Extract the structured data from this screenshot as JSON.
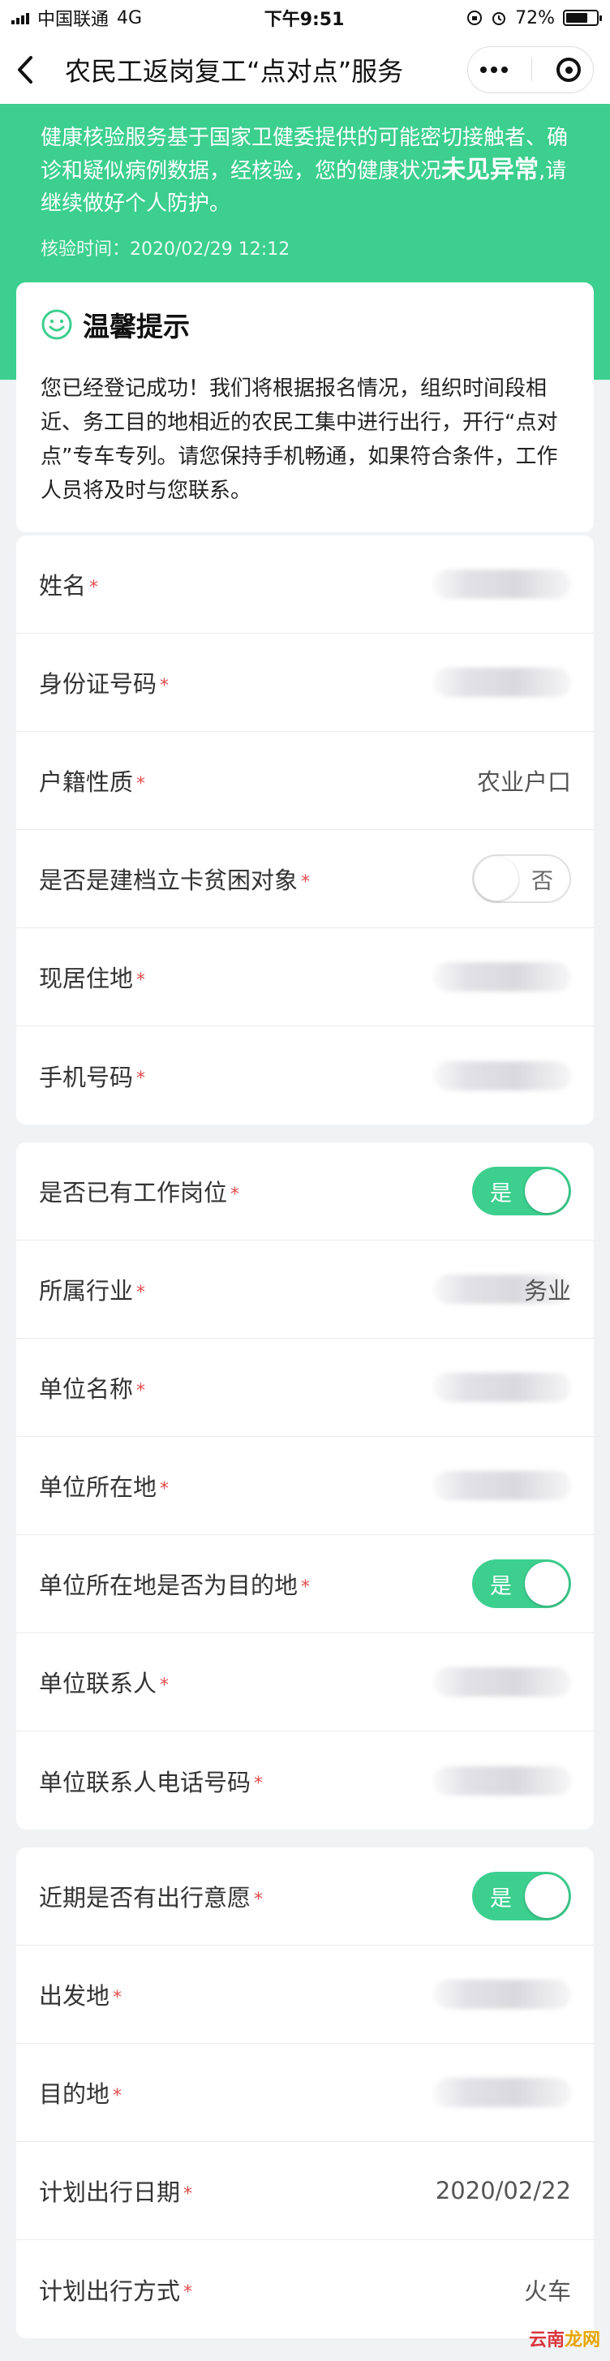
{
  "status_bar": {
    "carrier": "中国联通",
    "network": "4G",
    "time": "下午9:51",
    "battery": "72%",
    "battery_level": 0.72
  },
  "nav": {
    "title": "农民工返岗复工“点对点”服务"
  },
  "health": {
    "text_before": "健康核验服务基于国家卫健委提供的可能密切接触者、确诊和疑似病例数据，经核验，您的健康状况",
    "status": "未见异常",
    "text_after": ",请继续做好个人防护。",
    "verify_time": "核验时间：2020/02/29 12:12"
  },
  "tip": {
    "title": "温馨提示",
    "body": "您已经登记成功！我们将根据报名情况，组织时间段相近、务工目的地相近的农民工集中进行出行，开行“点对点”专车专列。请您保持手机畅通，如果符合条件，工作人员将及时与您联系。"
  },
  "required_mark": "*",
  "sections": [
    {
      "rows": [
        {
          "label": "姓名",
          "kind": "blur"
        },
        {
          "label": "身份证号码",
          "kind": "blur"
        },
        {
          "label": "户籍性质",
          "kind": "text",
          "value": "农业户口"
        },
        {
          "label": "是否是建档立卡贫困对象",
          "kind": "toggle",
          "on": false,
          "toggle_text": "否"
        },
        {
          "label": "现居住地",
          "kind": "blur"
        },
        {
          "label": "手机号码",
          "kind": "blur"
        }
      ]
    },
    {
      "rows": [
        {
          "label": "是否已有工作岗位",
          "kind": "toggle",
          "on": true,
          "toggle_text": "是"
        },
        {
          "label": "所属行业",
          "kind": "blur",
          "value": "务业"
        },
        {
          "label": "单位名称",
          "kind": "blur"
        },
        {
          "label": "单位所在地",
          "kind": "blur"
        },
        {
          "label": "单位所在地是否为目的地",
          "kind": "toggle",
          "on": true,
          "toggle_text": "是"
        },
        {
          "label": "单位联系人",
          "kind": "blur"
        },
        {
          "label": "单位联系人电话号码",
          "kind": "blur"
        }
      ]
    },
    {
      "rows": [
        {
          "label": "近期是否有出行意愿",
          "kind": "toggle",
          "on": true,
          "toggle_text": "是"
        },
        {
          "label": "出发地",
          "kind": "blur"
        },
        {
          "label": "目的地",
          "kind": "blur"
        },
        {
          "label": "计划出行日期",
          "kind": "text",
          "value": "2020/02/22"
        },
        {
          "label": "计划出行方式",
          "kind": "text",
          "value": "火车"
        }
      ]
    }
  ],
  "watermark": {
    "part1": "云南",
    "part2": "龙网"
  },
  "colors": {
    "brand_green": "#3ccf8e",
    "required_red": "#e34c4c"
  }
}
